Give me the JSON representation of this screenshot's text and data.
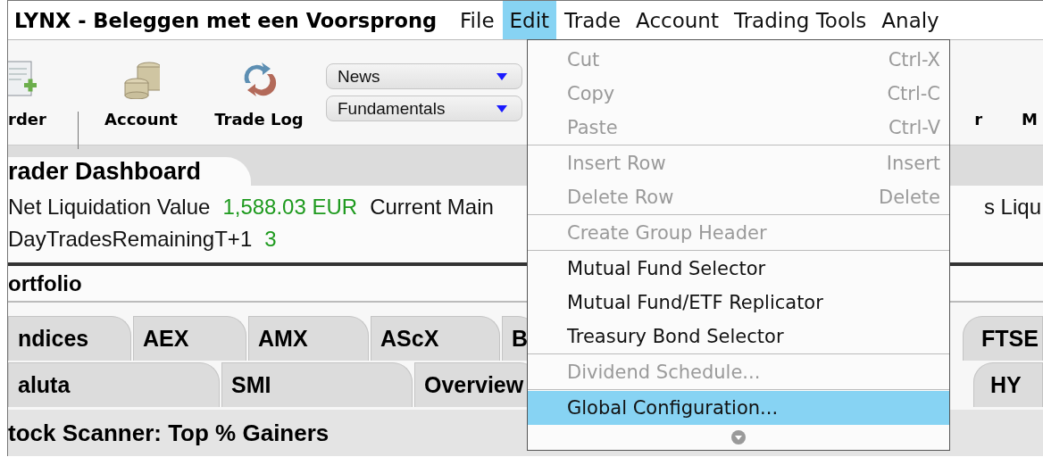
{
  "window": {
    "title": "LYNX - Beleggen met een Voorsprong"
  },
  "menubar": [
    {
      "label": "File",
      "selected": false
    },
    {
      "label": "Edit",
      "selected": true
    },
    {
      "label": "Trade",
      "selected": false
    },
    {
      "label": "Account",
      "selected": false
    },
    {
      "label": "Trading Tools",
      "selected": false
    },
    {
      "label": "Analy",
      "selected": false
    }
  ],
  "toolbar": {
    "buttons": [
      {
        "label": "rder",
        "kind": "order"
      },
      {
        "label": "Account",
        "kind": "coins"
      },
      {
        "label": "Trade Log",
        "kind": "sync"
      }
    ],
    "dropdowns": [
      {
        "label": "News"
      },
      {
        "label": "Fundamentals"
      }
    ],
    "right_labels": [
      "r",
      "M"
    ]
  },
  "dashboard": {
    "title": "rader Dashboard",
    "rows": [
      {
        "label": "Net Liquidation Value",
        "value": "1,588.03 EUR",
        "next_label": "Current Main",
        "right_text": "s Liqu"
      },
      {
        "label": "DayTradesRemainingT+1",
        "value": "3"
      }
    ]
  },
  "portfolio": {
    "title": "ortfolio"
  },
  "tab_rows": [
    {
      "left": [
        {
          "label": "ndices",
          "selected": false
        },
        {
          "label": "AEX",
          "selected": false
        },
        {
          "label": "AMX",
          "selected": false
        },
        {
          "label": "AScX",
          "selected": false
        },
        {
          "label": "B",
          "selected": false
        }
      ],
      "right": [
        {
          "label": "FTSE",
          "selected": false
        }
      ]
    },
    {
      "left": [
        {
          "label": "aluta",
          "selected": false
        },
        {
          "label": "SMI",
          "selected": false
        },
        {
          "label": "Overview",
          "selected": false
        }
      ],
      "right": [
        {
          "label": "HY",
          "selected": false
        }
      ]
    }
  ],
  "scanner": {
    "title": "tock Scanner: Top % Gainers"
  },
  "edit_menu": {
    "items": [
      {
        "kind": "item",
        "label": "Cut",
        "shortcut": "Ctrl-X",
        "disabled": true,
        "selected": false
      },
      {
        "kind": "item",
        "label": "Copy",
        "shortcut": "Ctrl-C",
        "disabled": true,
        "selected": false
      },
      {
        "kind": "item",
        "label": "Paste",
        "shortcut": "Ctrl-V",
        "disabled": true,
        "selected": false
      },
      {
        "kind": "separator"
      },
      {
        "kind": "item",
        "label": "Insert Row",
        "shortcut": "Insert",
        "disabled": true,
        "selected": false
      },
      {
        "kind": "item",
        "label": "Delete Row",
        "shortcut": "Delete",
        "disabled": true,
        "selected": false
      },
      {
        "kind": "separator"
      },
      {
        "kind": "item",
        "label": "Create Group Header",
        "disabled": true,
        "selected": false
      },
      {
        "kind": "separator"
      },
      {
        "kind": "item",
        "label": "Mutual Fund Selector",
        "disabled": false,
        "selected": false
      },
      {
        "kind": "item",
        "label": "Mutual Fund/ETF Replicator",
        "disabled": false,
        "selected": false
      },
      {
        "kind": "item",
        "label": "Treasury Bond Selector",
        "disabled": false,
        "selected": false
      },
      {
        "kind": "separator"
      },
      {
        "kind": "item",
        "label": "Dividend Schedule...",
        "disabled": true,
        "selected": false
      },
      {
        "kind": "separator"
      },
      {
        "kind": "item",
        "label": "Global Configuration...",
        "disabled": false,
        "selected": true
      },
      {
        "kind": "scroll"
      }
    ]
  }
}
